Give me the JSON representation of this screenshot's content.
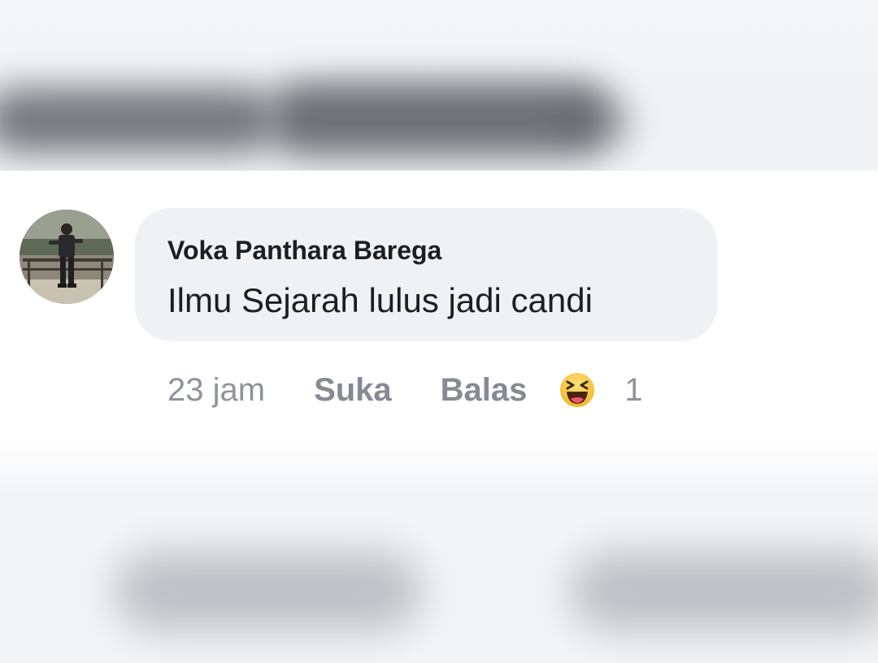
{
  "comment": {
    "author": "Voka Panthara Barega",
    "text": "Ilmu Sejarah lulus jadi candi",
    "timestamp": "23 jam",
    "like_label": "Suka",
    "reply_label": "Balas",
    "reaction_icon": "laughing-emoji-icon",
    "reaction_count": "1"
  },
  "colors": {
    "bubble": "#eff1f4",
    "author_text": "#1c1e21",
    "muted_text": "#8e939b",
    "reaction_yellow": "#f7c53a"
  }
}
